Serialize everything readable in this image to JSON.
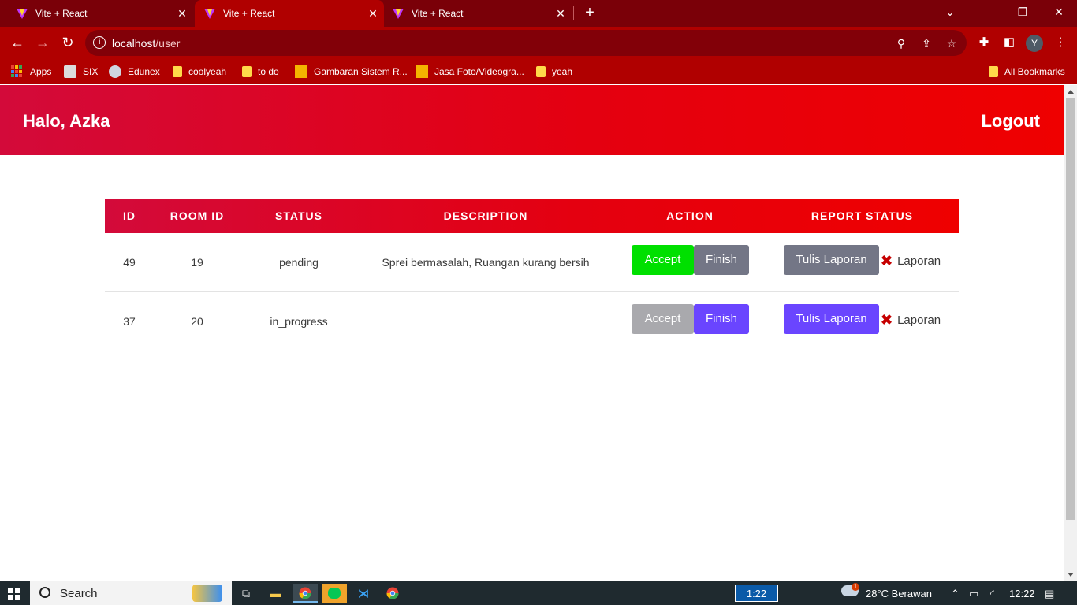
{
  "browser": {
    "tabs": [
      {
        "title": "Vite + React"
      },
      {
        "title": "Vite + React"
      },
      {
        "title": "Vite + React"
      }
    ],
    "url_host": "localhost",
    "url_path": "/user",
    "bookmarks": [
      {
        "label": "Apps"
      },
      {
        "label": "SIX"
      },
      {
        "label": "Edunex"
      },
      {
        "label": "coolyeah"
      },
      {
        "label": "to do"
      },
      {
        "label": "Gambaran Sistem R..."
      },
      {
        "label": "Jasa Foto/Videogra..."
      },
      {
        "label": "yeah"
      }
    ],
    "all_bookmarks": "All Bookmarks",
    "profile_initial": "Y"
  },
  "header": {
    "greeting": "Halo, Azka",
    "logout": "Logout"
  },
  "table": {
    "columns": [
      "ID",
      "ROOM ID",
      "STATUS",
      "DESCRIPTION",
      "ACTION",
      "REPORT STATUS"
    ],
    "rows": [
      {
        "id": "49",
        "room_id": "19",
        "status": "pending",
        "description": "Sprei bermasalah, Ruangan kurang bersih",
        "accept_label": "Accept",
        "finish_label": "Finish",
        "report_button": "Tulis Laporan",
        "report_status": "Laporan"
      },
      {
        "id": "37",
        "room_id": "20",
        "status": "in_progress",
        "description": "",
        "accept_label": "Accept",
        "finish_label": "Finish",
        "report_button": "Tulis Laporan",
        "report_status": "Laporan"
      }
    ]
  },
  "taskbar": {
    "search": "Search",
    "timer": "1:22",
    "weather": "28°C  Berawan",
    "clock": "12:22",
    "weather_badge": "1"
  },
  "colors": {
    "accent_red": "#e40010",
    "accept_green": "#00e000",
    "finish_purple": "#6a45ff",
    "disabled_gray": "#a9a9ad",
    "muted_gray": "#737686"
  }
}
